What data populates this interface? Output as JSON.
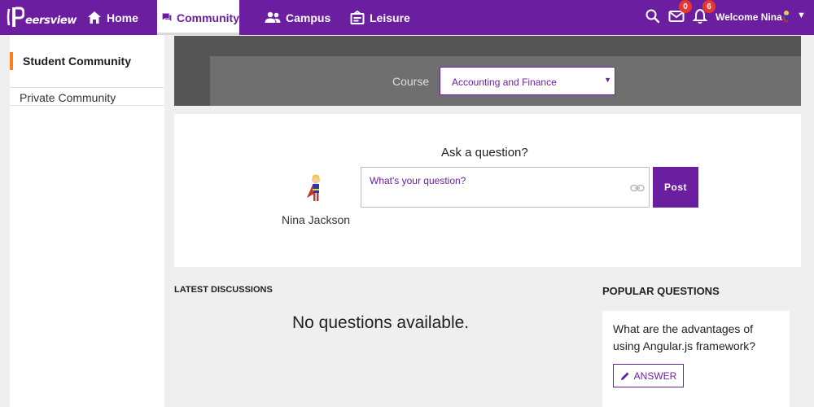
{
  "app": {
    "logo_text": "eersview"
  },
  "nav": {
    "home": "Home",
    "community": "Community",
    "campus": "Campus",
    "leisure": "Leisure"
  },
  "header": {
    "mail_count": "0",
    "notification_count": "6",
    "welcome": "Welcome Nina"
  },
  "sidebar": {
    "items": [
      {
        "label": "Student Community",
        "active": true
      },
      {
        "label": "Private Community",
        "active": false
      }
    ]
  },
  "course": {
    "label": "Course",
    "selected": "Accounting and Finance"
  },
  "ask": {
    "title": "Ask a question?",
    "user_name": "Nina Jackson",
    "placeholder": "What's your question?",
    "post_label": "Post"
  },
  "discussions": {
    "latest_heading": "LATEST DISCUSSIONS",
    "empty_message": "No questions available.",
    "popular_heading": "POPULAR QUESTIONS",
    "popular": [
      {
        "question": "What are the advantages of using Angular.js framework?",
        "answer_label": "ANSWER"
      }
    ]
  },
  "colors": {
    "brand": "#6b1fa0",
    "accent": "#ff7f1f",
    "badge": "#e8382d"
  }
}
